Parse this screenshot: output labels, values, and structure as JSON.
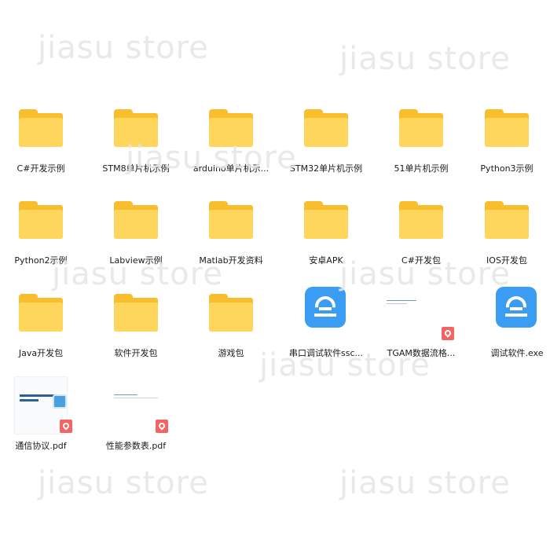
{
  "watermark": "jiasu store",
  "rows": [
    [
      {
        "label": "C#开发示例",
        "type": "folder"
      },
      {
        "label": "STM8单片机示例",
        "type": "folder"
      },
      {
        "label": "arduino单片机示...",
        "type": "folder"
      },
      {
        "label": "STM32单片机示例",
        "type": "folder"
      },
      {
        "label": "51单片机示例",
        "type": "folder"
      },
      {
        "label": "Python3示例",
        "type": "folder"
      }
    ],
    [
      {
        "label": "Python2示例",
        "type": "folder"
      },
      {
        "label": "Labview示例",
        "type": "folder"
      },
      {
        "label": "Matlab开发资料",
        "type": "folder"
      },
      {
        "label": "安卓APK",
        "type": "folder"
      },
      {
        "label": "C#开发包",
        "type": "folder"
      },
      {
        "label": "IOS开发包",
        "type": "folder"
      }
    ],
    [
      {
        "label": "Java开发包",
        "type": "folder"
      },
      {
        "label": "软件开发包",
        "type": "folder"
      },
      {
        "label": "游戏包",
        "type": "folder"
      },
      {
        "label": "串口调试软件ssc...",
        "type": "exe"
      },
      {
        "label": "TGAM数据流格...",
        "type": "pdf-plain"
      },
      {
        "label": "调试软件.exe",
        "type": "exe"
      }
    ],
    [
      {
        "label": "通信协议.pdf",
        "type": "pdf-cover"
      },
      {
        "label": "性能参数表.pdf",
        "type": "pdf-plain"
      }
    ]
  ]
}
